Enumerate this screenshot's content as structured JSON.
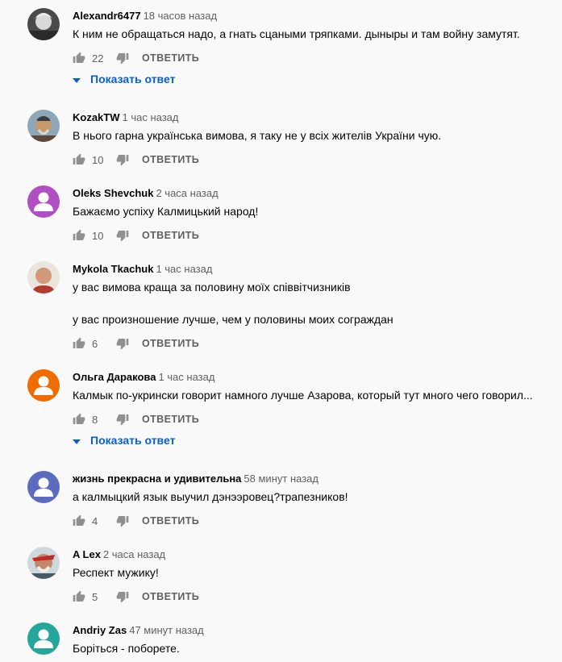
{
  "comments": [
    {
      "author": "Alexandr6477",
      "time": "18 часов назад",
      "text": [
        "К ним не обращаться надо, а гнать сцаными тряпками.  дыныры и там войну замутят."
      ],
      "likes": "22",
      "reply": "ОТВЕТИТЬ",
      "show_reply": "Показать ответ",
      "avatar": "photo"
    },
    {
      "author": "KozakTW",
      "time": "1 час назад",
      "text": [
        "В нього гарна українська вимова, я таку не у всіх жителів України чую."
      ],
      "likes": "10",
      "reply": "ОТВЕТИТЬ",
      "avatar": "photo"
    },
    {
      "author": "Oleks Shevchuk",
      "time": "2 часа назад",
      "text": [
        "Бажаємо успіху Калмицький народ!"
      ],
      "likes": "10",
      "reply": "ОТВЕТИТЬ",
      "avatar": "default",
      "avatar_color": "#b04ec4"
    },
    {
      "author": "Mykola Tkachuk",
      "time": "1 час назад",
      "text": [
        "у вас вимова краща за половину моїх співвітчизників",
        "у вас произношение лучше, чем у половины моих сограждан"
      ],
      "likes": "6",
      "reply": "ОТВЕТИТЬ",
      "avatar": "photo"
    },
    {
      "author": "Ольга Даракова",
      "time": "1 час назад",
      "text": [
        "Калмык по-укрински говорит намного лучше Азарова, который тут много чего говорил..."
      ],
      "likes": "8",
      "reply": "ОТВЕТИТЬ",
      "show_reply": "Показать ответ",
      "avatar": "default",
      "avatar_color": "#ef6c00"
    },
    {
      "author": "жизнь прекрасна и удивительна",
      "time": "58 минут назад",
      "text": [
        "а калмыцкий язык выучил дэнээровец?трапезников!"
      ],
      "likes": "4",
      "reply": "ОТВЕТИТЬ",
      "avatar": "default",
      "avatar_color": "#5c6bc0"
    },
    {
      "author": "A Lex",
      "time": "2 часа назад",
      "text": [
        "Респект мужику!"
      ],
      "likes": "5",
      "reply": "ОТВЕТИТЬ",
      "avatar": "photo"
    },
    {
      "author": "Andriy Zas",
      "time": "47 минут назад",
      "text": [
        "Боріться - поборете."
      ],
      "avatar": "default",
      "avatar_color": "#26a69a"
    }
  ]
}
